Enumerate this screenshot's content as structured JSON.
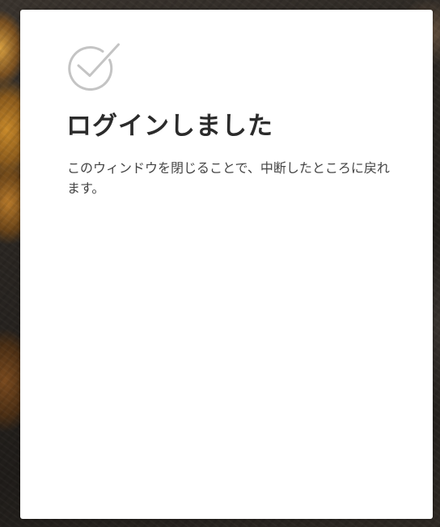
{
  "dialog": {
    "icon": "check-circle-icon",
    "title": "ログインしました",
    "message": "このウィンドウを閉じることで、中断したところに戻れます。"
  },
  "colors": {
    "card_background": "#ffffff",
    "title": "#2b2b2b",
    "message": "#444444",
    "icon_stroke": "#c4c4c4"
  }
}
